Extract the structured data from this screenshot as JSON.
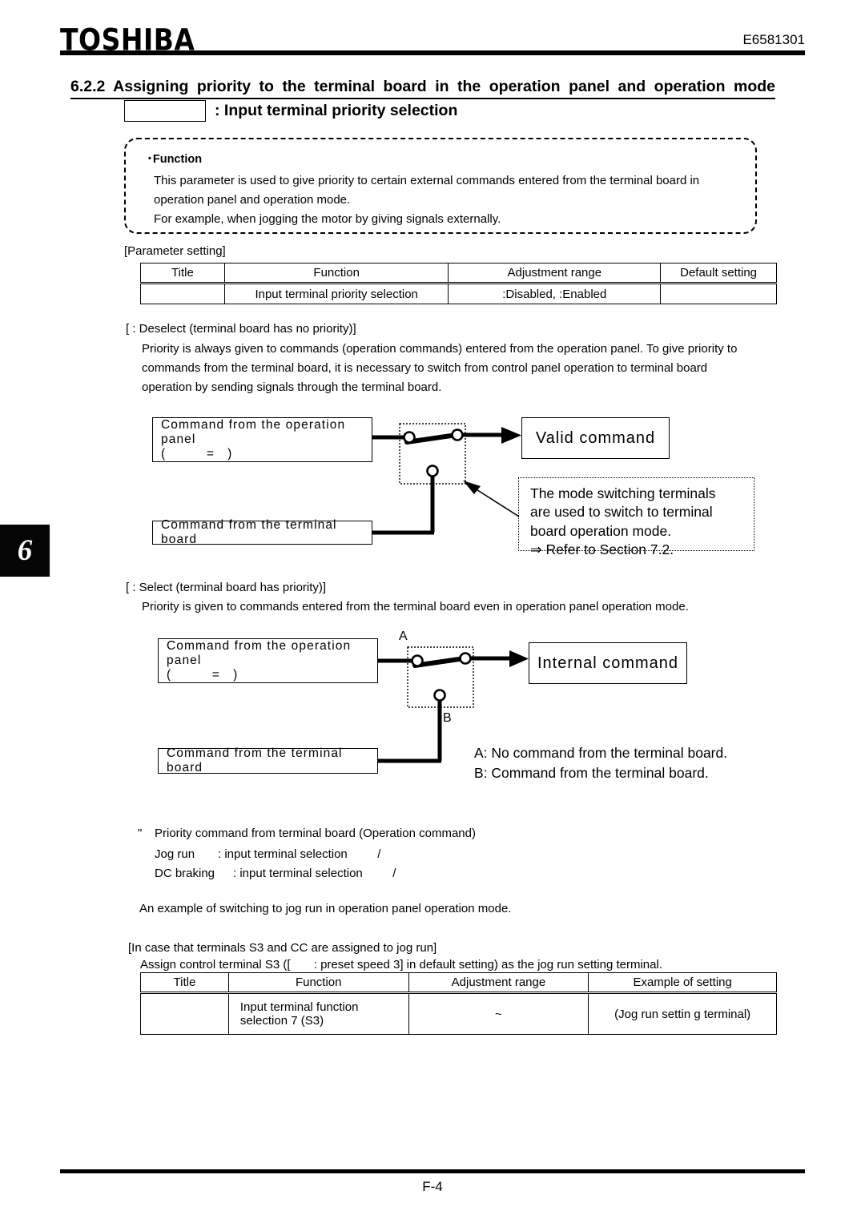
{
  "header": {
    "brand": "TOSHIBA",
    "doc_number": "E6581301"
  },
  "chapter_tab": "6",
  "section": {
    "number_and_title": "6.2.2  Assigning priority to the terminal board in the operation panel and operation mode",
    "parameter_box_value": "",
    "parameter_label": ": Input terminal priority selection"
  },
  "function_box": {
    "heading": "Function",
    "bullet": "•",
    "line1": "This parameter is used to give priority to certain external commands entered from the terminal board in",
    "line2": "operation panel and operation mode.",
    "line3": "For example, when jogging the motor by giving signals externally."
  },
  "parameter_setting": {
    "caption": "[Parameter setting]",
    "headers": [
      "Title",
      "Function",
      "Adjustment range",
      "Default setting"
    ],
    "rows": [
      {
        "title": "",
        "function": "Input terminal priority selection",
        "adjustment_range": ":Disabled,    :Enabled",
        "default_setting": ""
      }
    ]
  },
  "deselect_section": {
    "heading": "[   : Deselect (terminal board has no priority)]",
    "line1": "Priority is always given to commands (operation commands) entered from the operation panel. To give priority to",
    "line2": "commands from the terminal board, it is necessary to switch from control panel operation to terminal board",
    "line3": "operation by sending signals through the terminal board."
  },
  "diagram1": {
    "op_panel_box_line1": "Command from the operation panel",
    "op_panel_box_line2": "(            =    )",
    "terminal_box": "Command from the terminal board",
    "output_box": "Valid  command",
    "note_line1": "The mode switching terminals",
    "note_line2": "are used to switch to terminal",
    "note_line3": "board operation mode.",
    "note_line4": "⇒ Refer to Section 7.2."
  },
  "select_section": {
    "heading": "[   : Select (terminal board has priority)]",
    "line1": "Priority is given to commands entered from the terminal board even in operation panel operation mode."
  },
  "diagram2": {
    "op_panel_box_line1": "Command from the operation panel",
    "op_panel_box_line2": "(            =    )",
    "terminal_box": "Command from the terminal board",
    "output_box": "Internal  command",
    "label_a": "A",
    "label_b": "B",
    "legend_a": "A: No command from the terminal board.",
    "legend_b": "B: Command from the terminal board."
  },
  "priority_command": {
    "marker": "\"",
    "heading": "Priority command from terminal board (Operation command)",
    "item1_label": "Jog run",
    "item1_value": ": input terminal selection         /",
    "item2_label": "DC braking",
    "item2_value": ": input terminal selection         /",
    "example_note": "An example of switching to jog run in operation panel operation mode."
  },
  "jog_example": {
    "heading": "[In case that terminals S3 and CC are assigned to jog run]",
    "instruction": "Assign control terminal S3 ([       : preset speed 3] in default setting) as the jog run setting terminal.",
    "headers": [
      "Title",
      "Function",
      "Adjustment range",
      "Example of setting"
    ],
    "rows": [
      {
        "title": "",
        "function_line1": "Input terminal function",
        "function_line2": "selection 7 (S3)",
        "adjustment_range": "~",
        "example_of_setting": "(Jog run settin g terminal)"
      }
    ]
  },
  "footer": {
    "page": "F-4"
  }
}
